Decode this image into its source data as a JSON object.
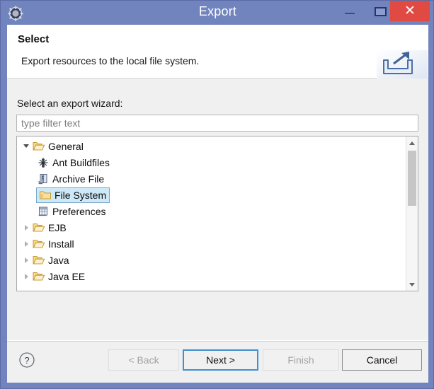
{
  "window": {
    "title": "Export",
    "app_icon": "gear-icon",
    "controls": {
      "minimize": "minimize-icon",
      "maximize": "maximize-icon",
      "close": "close-icon",
      "close_glyph": "✕",
      "close_bg": "#e04a43"
    },
    "titlebar_bg": "#7184be"
  },
  "header": {
    "title": "Select",
    "description": "Export resources to the local file system.",
    "icon": "export-arrow-tray-icon"
  },
  "main": {
    "field_label": "Select an export wizard:",
    "filter": {
      "value": "",
      "placeholder": "type filter text"
    },
    "tree": {
      "selected": "File System",
      "selection_bg": "#cde8f6",
      "selection_border": "#7aa9c9",
      "items": [
        {
          "label": "General",
          "icon": "open-folder-icon",
          "state": "expanded",
          "depth": 0
        },
        {
          "label": "Ant Buildfiles",
          "icon": "ant-icon",
          "state": "leaf",
          "depth": 1
        },
        {
          "label": "Archive File",
          "icon": "archive-file-icon",
          "state": "leaf",
          "depth": 1
        },
        {
          "label": "File System",
          "icon": "folder-icon",
          "state": "leaf",
          "depth": 1
        },
        {
          "label": "Preferences",
          "icon": "preferences-icon",
          "state": "leaf",
          "depth": 1
        },
        {
          "label": "EJB",
          "icon": "open-folder-icon",
          "state": "collapsed",
          "depth": 0
        },
        {
          "label": "Install",
          "icon": "open-folder-icon",
          "state": "collapsed",
          "depth": 0
        },
        {
          "label": "Java",
          "icon": "open-folder-icon",
          "state": "collapsed",
          "depth": 0
        },
        {
          "label": "Java EE",
          "icon": "open-folder-icon",
          "state": "collapsed",
          "depth": 0
        }
      ]
    },
    "scrollbar": {
      "up_arrow": "chevron-up-icon",
      "down_arrow": "chevron-down-icon",
      "thumb_color": "#c6c6c6"
    }
  },
  "footer": {
    "help_icon": "help-question-icon",
    "buttons": [
      {
        "id": "back",
        "label": "< Back",
        "enabled": false,
        "focused": false
      },
      {
        "id": "next",
        "label": "Next >",
        "enabled": true,
        "focused": true
      },
      {
        "id": "finish",
        "label": "Finish",
        "enabled": false,
        "focused": false
      },
      {
        "id": "cancel",
        "label": "Cancel",
        "enabled": true,
        "focused": false
      }
    ],
    "focus_color": "#3f8fd2"
  }
}
